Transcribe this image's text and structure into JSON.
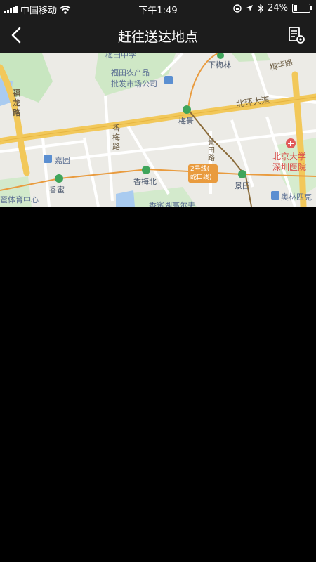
{
  "status_bar": {
    "carrier": "中国移动",
    "time": "下午1:49",
    "battery_percent": "24%",
    "battery_level": 0.24
  },
  "nav": {
    "title": "赶往送达地点",
    "back_icon": "chevron-left-icon",
    "right_icon": "document-settings-icon"
  },
  "map": {
    "labels": {
      "poi_top": "梅田中学",
      "market": "福田农产品\n批发市场公司",
      "xiameilin": "下梅林",
      "meihua_rd": "梅华路",
      "fulong_rd": "福\n龙\n路",
      "beihuan": "北环大道",
      "meijing": "梅景",
      "xiangmei_rd": "香\n梅\n路",
      "jingtian_rd": "景\n田\n路",
      "hospital": "北京大学\n深圳医院",
      "jiayuan": "嘉园",
      "xiangmeibei": "香梅北",
      "line2": "2号线(\n蛇口线)",
      "jingtian": "景田",
      "xiangmi": "香蜜",
      "sports": "蜜体育中心",
      "olympic": "奥林匹克",
      "lake": "香蜜湖高尔夫"
    }
  }
}
